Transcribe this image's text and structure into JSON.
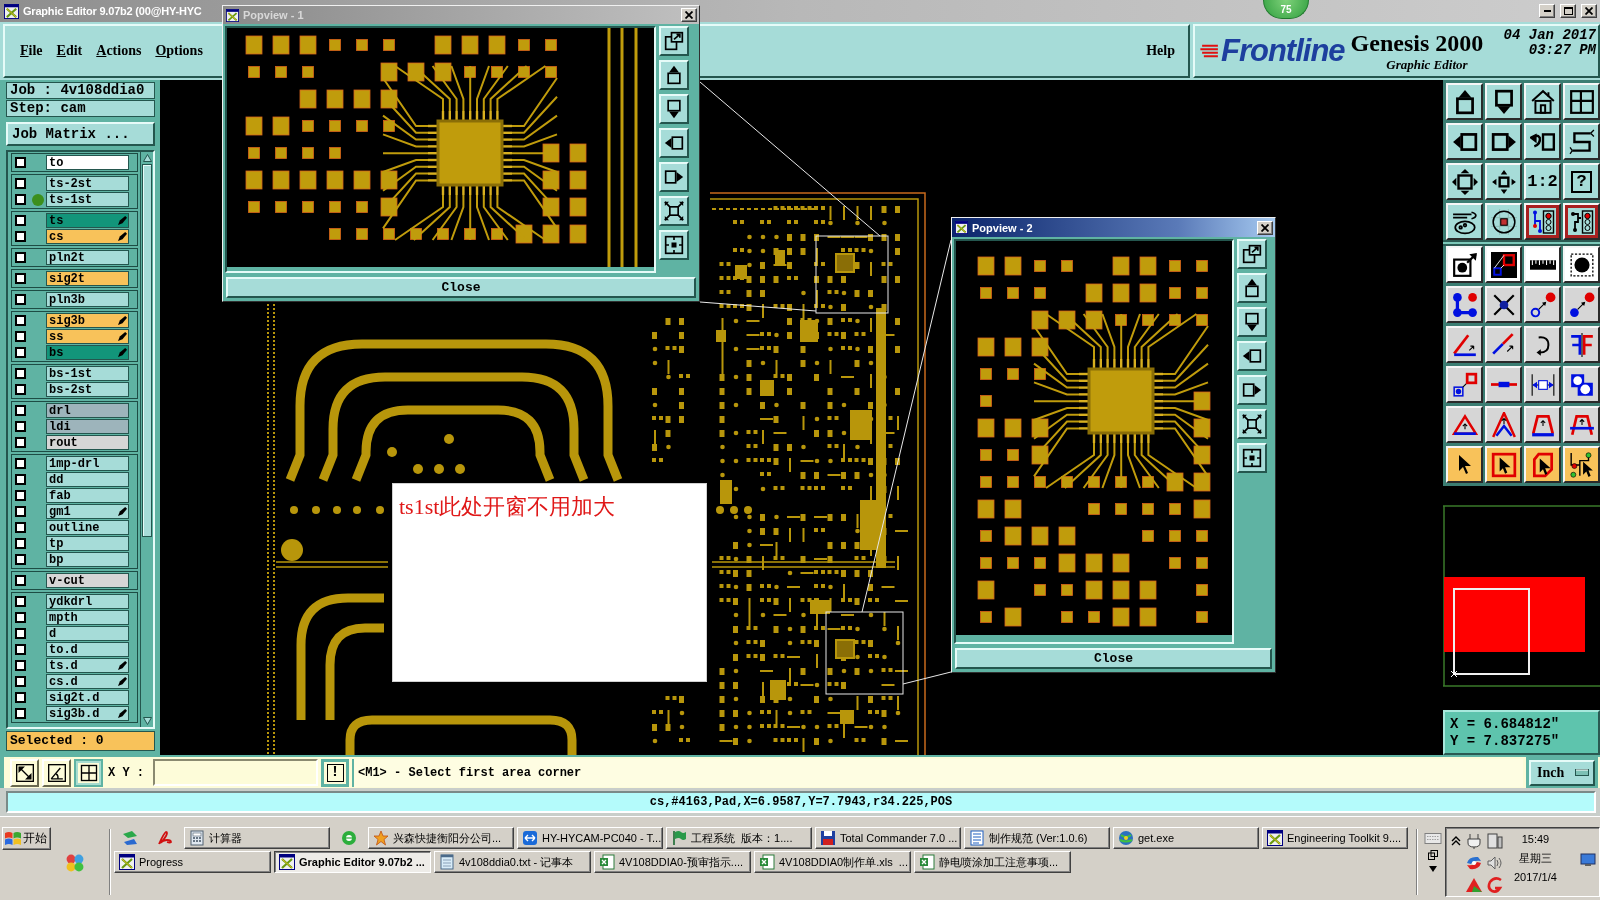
{
  "window": {
    "title": "Graphic Editor 9.07b2 (00@HY-HYC"
  },
  "counter_badge": {
    "text": "75"
  },
  "menu": {
    "items": [
      "File",
      "Edit",
      "Actions",
      "Options"
    ],
    "help": "Help"
  },
  "brand": {
    "logo": "Frontline",
    "product": "Genesis 2000",
    "module": "Graphic Editor",
    "date": "04 Jan 2017",
    "time": "03:27 PM"
  },
  "job": {
    "job": "Job : 4v108ddia0",
    "step": "Step: cam",
    "matrix_button": "Job Matrix ..."
  },
  "layer_groups": [
    {
      "layers": [
        {
          "name": "to",
          "color": "#ffffff",
          "checked": false,
          "displayed": false,
          "affected": false
        }
      ]
    },
    {
      "layers": [
        {
          "name": "ts-2st",
          "color": "#a6dcd8",
          "checked": false,
          "displayed": false,
          "affected": false
        },
        {
          "name": "ts-1st",
          "color": "#a6dcd8",
          "checked": false,
          "displayed": true,
          "affected": false
        }
      ]
    },
    {
      "layers": [
        {
          "name": "ts",
          "color": "#12957a",
          "checked": false,
          "displayed": false,
          "affected": true
        },
        {
          "name": "cs",
          "color": "#f8c25a",
          "checked": false,
          "displayed": false,
          "affected": true
        }
      ]
    },
    {
      "layers": [
        {
          "name": "pln2t",
          "color": "#a6dcd8",
          "checked": false,
          "displayed": false,
          "affected": false
        }
      ]
    },
    {
      "layers": [
        {
          "name": "sig2t",
          "color": "#f8c25a",
          "checked": false,
          "displayed": false,
          "affected": false
        }
      ]
    },
    {
      "layers": [
        {
          "name": "pln3b",
          "color": "#a6dcd8",
          "checked": false,
          "displayed": false,
          "affected": false
        }
      ]
    },
    {
      "layers": [
        {
          "name": "sig3b",
          "color": "#f8c25a",
          "checked": false,
          "displayed": false,
          "affected": true
        },
        {
          "name": "ss",
          "color": "#f8c25a",
          "checked": false,
          "displayed": false,
          "affected": true
        },
        {
          "name": "bs",
          "color": "#12957a",
          "checked": false,
          "displayed": false,
          "affected": true
        }
      ]
    },
    {
      "layers": [
        {
          "name": "bs-1st",
          "color": "#a6dcd8",
          "checked": false,
          "displayed": false,
          "affected": false
        },
        {
          "name": "bs-2st",
          "color": "#a6dcd8",
          "checked": false,
          "displayed": false,
          "affected": false
        }
      ]
    },
    {
      "layers": [
        {
          "name": "drl",
          "color": "#9db4bb",
          "checked": false,
          "displayed": false,
          "affected": false
        },
        {
          "name": "ldi",
          "color": "#9db4bb",
          "checked": false,
          "displayed": false,
          "affected": false
        },
        {
          "name": "rout",
          "color": "#d6d6d6",
          "checked": false,
          "displayed": false,
          "affected": false
        }
      ]
    },
    {
      "layers": [
        {
          "name": "1mp-drl",
          "color": "#a6dcd8",
          "checked": false,
          "displayed": false,
          "affected": false
        },
        {
          "name": "dd",
          "color": "#a6dcd8",
          "checked": false,
          "displayed": false,
          "affected": false
        },
        {
          "name": "fab",
          "color": "#a6dcd8",
          "checked": false,
          "displayed": false,
          "affected": false
        },
        {
          "name": "gm1",
          "color": "#a6dcd8",
          "checked": false,
          "displayed": false,
          "affected": true
        },
        {
          "name": "outline",
          "color": "#a6dcd8",
          "checked": false,
          "displayed": false,
          "affected": false
        },
        {
          "name": "tp",
          "color": "#a6dcd8",
          "checked": false,
          "displayed": false,
          "affected": false
        },
        {
          "name": "bp",
          "color": "#a6dcd8",
          "checked": false,
          "displayed": false,
          "affected": false
        }
      ]
    },
    {
      "layers": [
        {
          "name": "v-cut",
          "color": "#d6d6d6",
          "checked": false,
          "displayed": false,
          "affected": false
        }
      ]
    },
    {
      "layers": [
        {
          "name": "ydkdrl",
          "color": "#a6dcd8",
          "checked": false,
          "displayed": false,
          "affected": false
        },
        {
          "name": "mpth",
          "color": "#a6dcd8",
          "checked": false,
          "displayed": false,
          "affected": false
        },
        {
          "name": "d",
          "color": "#a6dcd8",
          "checked": false,
          "displayed": false,
          "affected": false
        },
        {
          "name": "to.d",
          "color": "#a6dcd8",
          "checked": false,
          "displayed": false,
          "affected": false
        },
        {
          "name": "ts.d",
          "color": "#a6dcd8",
          "checked": false,
          "displayed": false,
          "affected": true
        },
        {
          "name": "cs.d",
          "color": "#a6dcd8",
          "checked": false,
          "displayed": false,
          "affected": true
        },
        {
          "name": "sig2t.d",
          "color": "#a6dcd8",
          "checked": false,
          "displayed": false,
          "affected": false
        },
        {
          "name": "sig3b.d",
          "color": "#a6dcd8",
          "checked": false,
          "displayed": false,
          "affected": true
        }
      ]
    }
  ],
  "selection": {
    "text": "Selected : 0"
  },
  "popviews": [
    {
      "title": "Popview - 1",
      "active": false,
      "close_button": "Close"
    },
    {
      "title": "Popview - 2",
      "active": true,
      "close_button": "Close"
    }
  ],
  "annotation": {
    "text": "ts1st此处开窗不用加大"
  },
  "toolbar": {
    "ratio_button": "1:2",
    "help_button": "?"
  },
  "coordinates": {
    "x": "X = 6.684812\"",
    "y": "Y = 7.837275\""
  },
  "command_line": {
    "buttons": [
      {
        "selected": false
      },
      {
        "selected": false
      },
      {
        "selected": true
      }
    ],
    "xy_label": "X Y :",
    "alert_button": "!",
    "message": "<M1> - Select first area corner",
    "units_button": "Inch"
  },
  "status_line": {
    "text": "cs,#4163,Pad,X=6.9587,Y=7.7943,r34.225,POS"
  },
  "taskbar": {
    "start_button": "开始",
    "upper_row": [
      {
        "kind": "launcher"
      },
      {
        "kind": "launcher"
      },
      {
        "kind": "task",
        "label": "计算器",
        "selected": false
      },
      {
        "kind": "launcher"
      },
      {
        "kind": "task",
        "label": "兴森快捷衡阳分公司...",
        "selected": false
      },
      {
        "kind": "task",
        "label": "HY-HYCAM-PC040 - T...",
        "selected": false
      },
      {
        "kind": "task",
        "label": "工程系统  版本：1....",
        "selected": false
      },
      {
        "kind": "task",
        "label": "Total Commander 7.0 ...",
        "selected": false
      },
      {
        "kind": "task",
        "label": "制作规范 (Ver:1.0.6)",
        "selected": false
      },
      {
        "kind": "task",
        "label": "get.exe",
        "selected": false
      },
      {
        "kind": "task",
        "label": "Engineering Toolkit 9....",
        "selected": false
      }
    ],
    "lower_row": [
      {
        "kind": "task",
        "label": "Progress",
        "selected": false
      },
      {
        "kind": "task",
        "label": "Graphic Editor 9.07b2 ...",
        "selected": true
      },
      {
        "kind": "task",
        "label": "4v108ddia0.txt - 记事本",
        "selected": false
      },
      {
        "kind": "task",
        "label": "4V108DDIA0-预审指示....",
        "selected": false
      },
      {
        "kind": "task",
        "label": "4V108DDIA0制作单.xls  ...",
        "selected": false
      },
      {
        "kind": "task",
        "label": "静电喷涂加工注意事项...",
        "selected": false
      }
    ],
    "clock": {
      "time": "15:49",
      "weekday": "星期三",
      "date": "2017/1/4"
    }
  }
}
